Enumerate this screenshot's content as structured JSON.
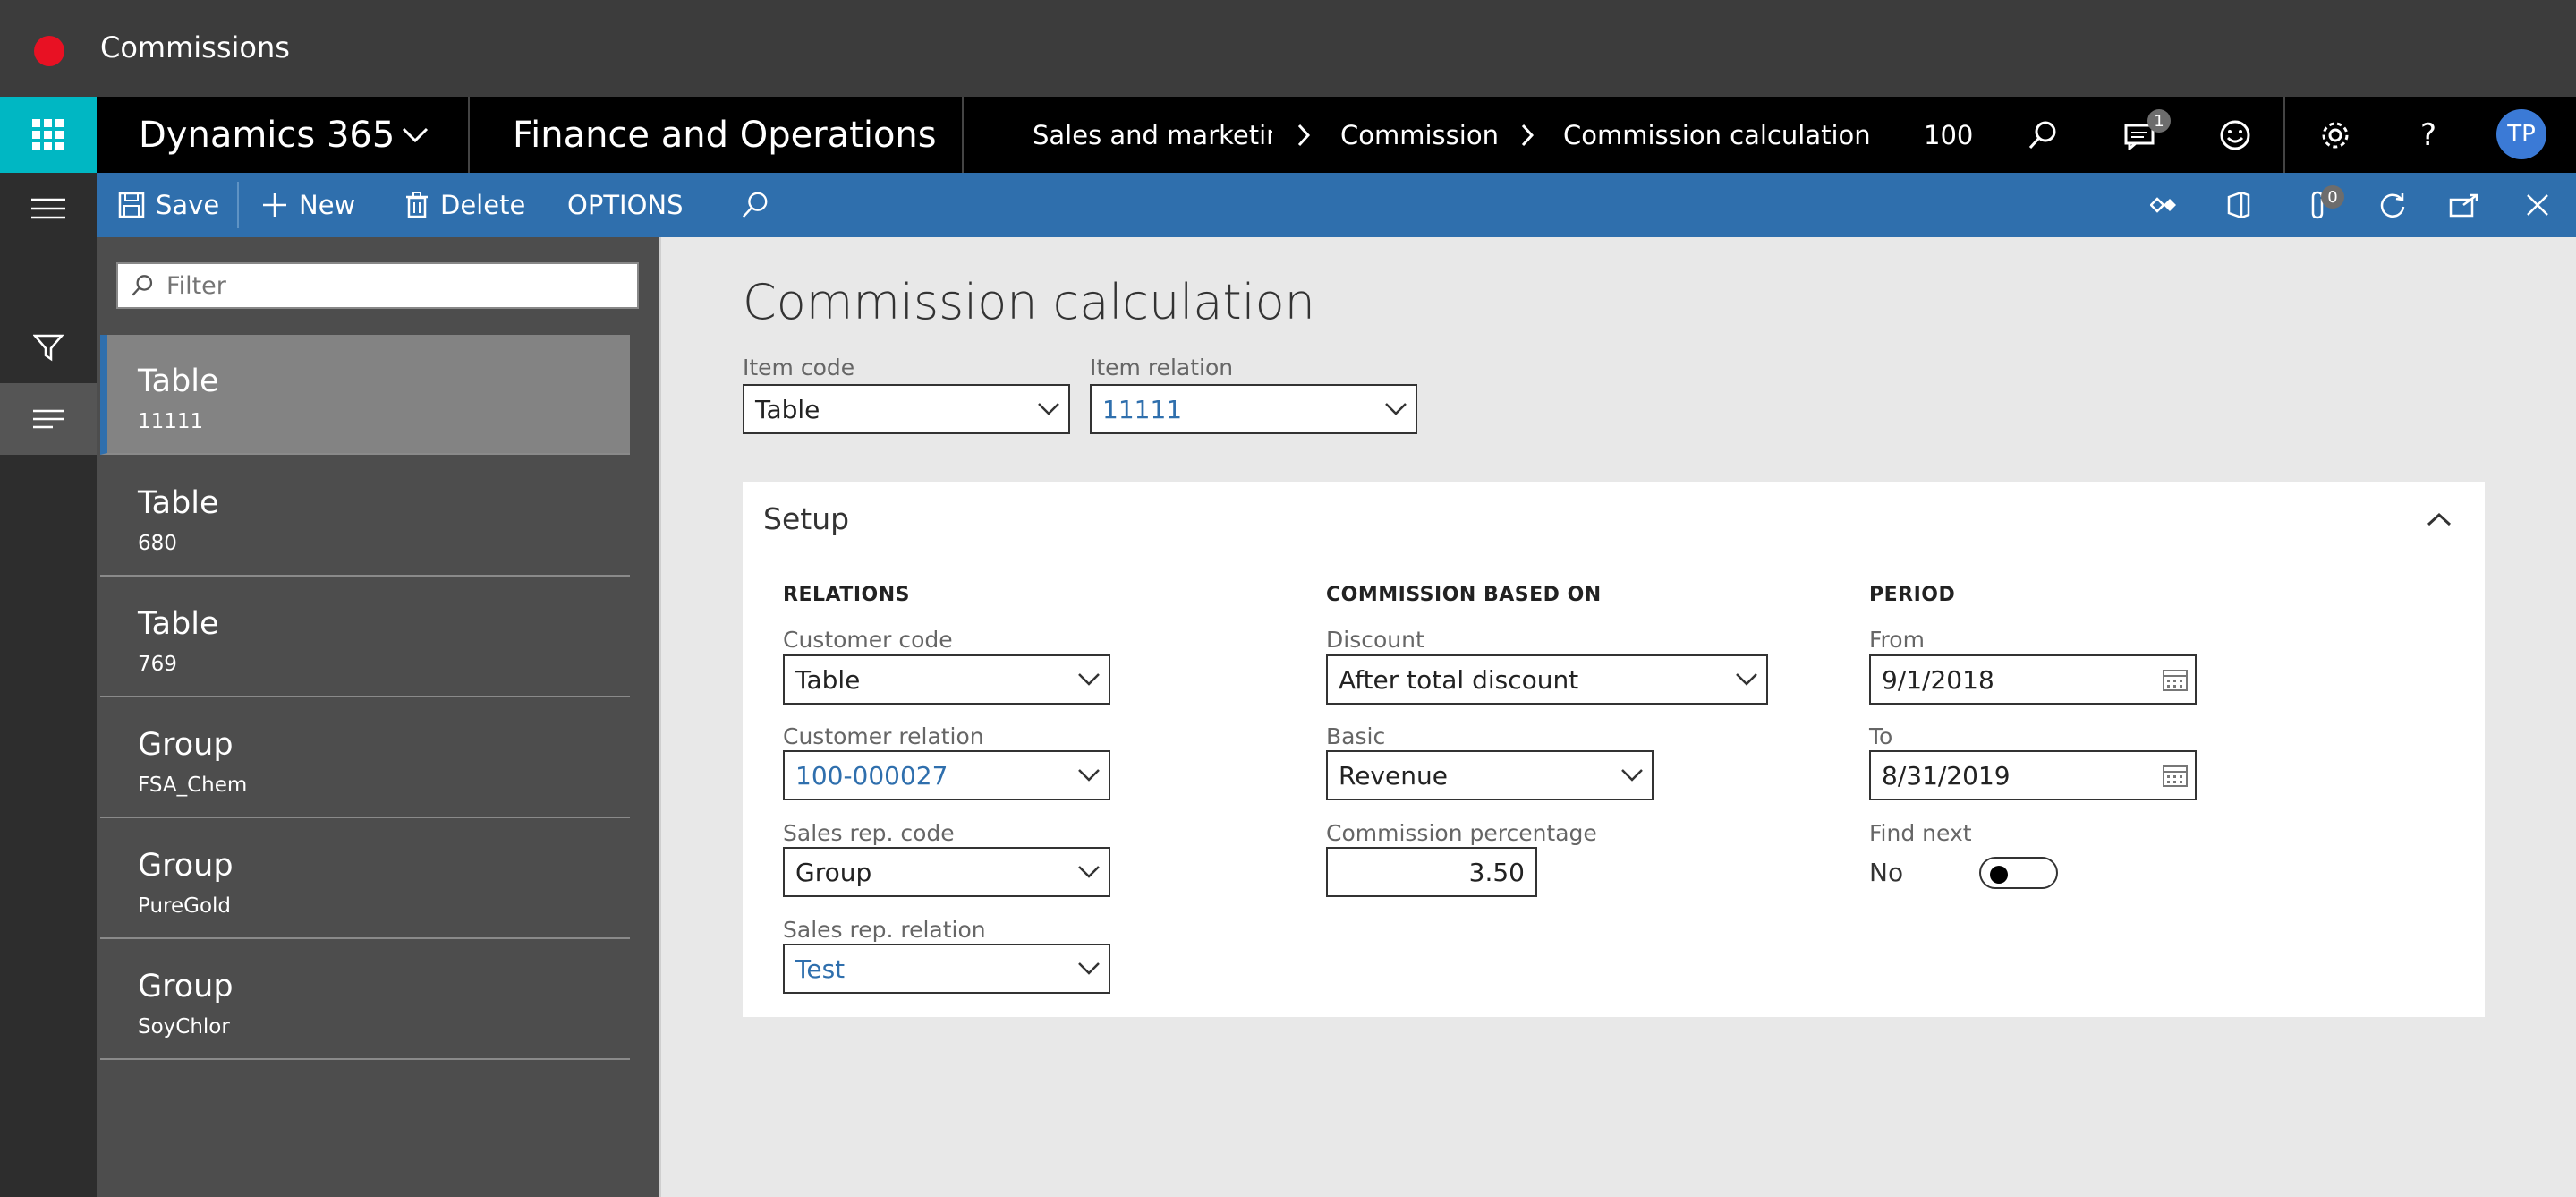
{
  "window": {
    "title": "Commissions"
  },
  "nav": {
    "app_name": "Dynamics 365",
    "module": "Finance and Operations",
    "breadcrumbs": [
      "Sales and marketing",
      "Commissions",
      "Commission calculation"
    ],
    "company": "100",
    "messages_badge": "1",
    "user_initials": "TP"
  },
  "actions": {
    "save": "Save",
    "new": "New",
    "delete": "Delete",
    "options": "OPTIONS",
    "attachments_badge": "0"
  },
  "list": {
    "filter_placeholder": "Filter",
    "items": [
      {
        "title": "Table",
        "subtitle": "11111",
        "selected": true
      },
      {
        "title": "Table",
        "subtitle": "680"
      },
      {
        "title": "Table",
        "subtitle": "769"
      },
      {
        "title": "Group",
        "subtitle": "FSA_Chem"
      },
      {
        "title": "Group",
        "subtitle": "PureGold"
      },
      {
        "title": "Group",
        "subtitle": "SoyChlor"
      }
    ]
  },
  "form": {
    "title": "Commission calculation",
    "item_code_label": "Item code",
    "item_code": "Table",
    "item_relation_label": "Item relation",
    "item_relation": "11111",
    "setup": {
      "title": "Setup",
      "relations": {
        "heading": "RELATIONS",
        "customer_code_label": "Customer code",
        "customer_code": "Table",
        "customer_relation_label": "Customer relation",
        "customer_relation": "100-000027",
        "sales_rep_code_label": "Sales rep. code",
        "sales_rep_code": "Group",
        "sales_rep_relation_label": "Sales rep. relation",
        "sales_rep_relation": "Test"
      },
      "commission": {
        "heading": "COMMISSION BASED ON",
        "discount_label": "Discount",
        "discount": "After total discount",
        "basic_label": "Basic",
        "basic": "Revenue",
        "percentage_label": "Commission percentage",
        "percentage": "3.50"
      },
      "period": {
        "heading": "PERIOD",
        "from_label": "From",
        "from": "9/1/2018",
        "to_label": "To",
        "to": "8/31/2019",
        "find_next_label": "Find next",
        "find_next": "No"
      }
    }
  },
  "colors": {
    "accent": "#2f6fad",
    "waffle": "#00b7c3",
    "close_dot": "#e81123"
  }
}
